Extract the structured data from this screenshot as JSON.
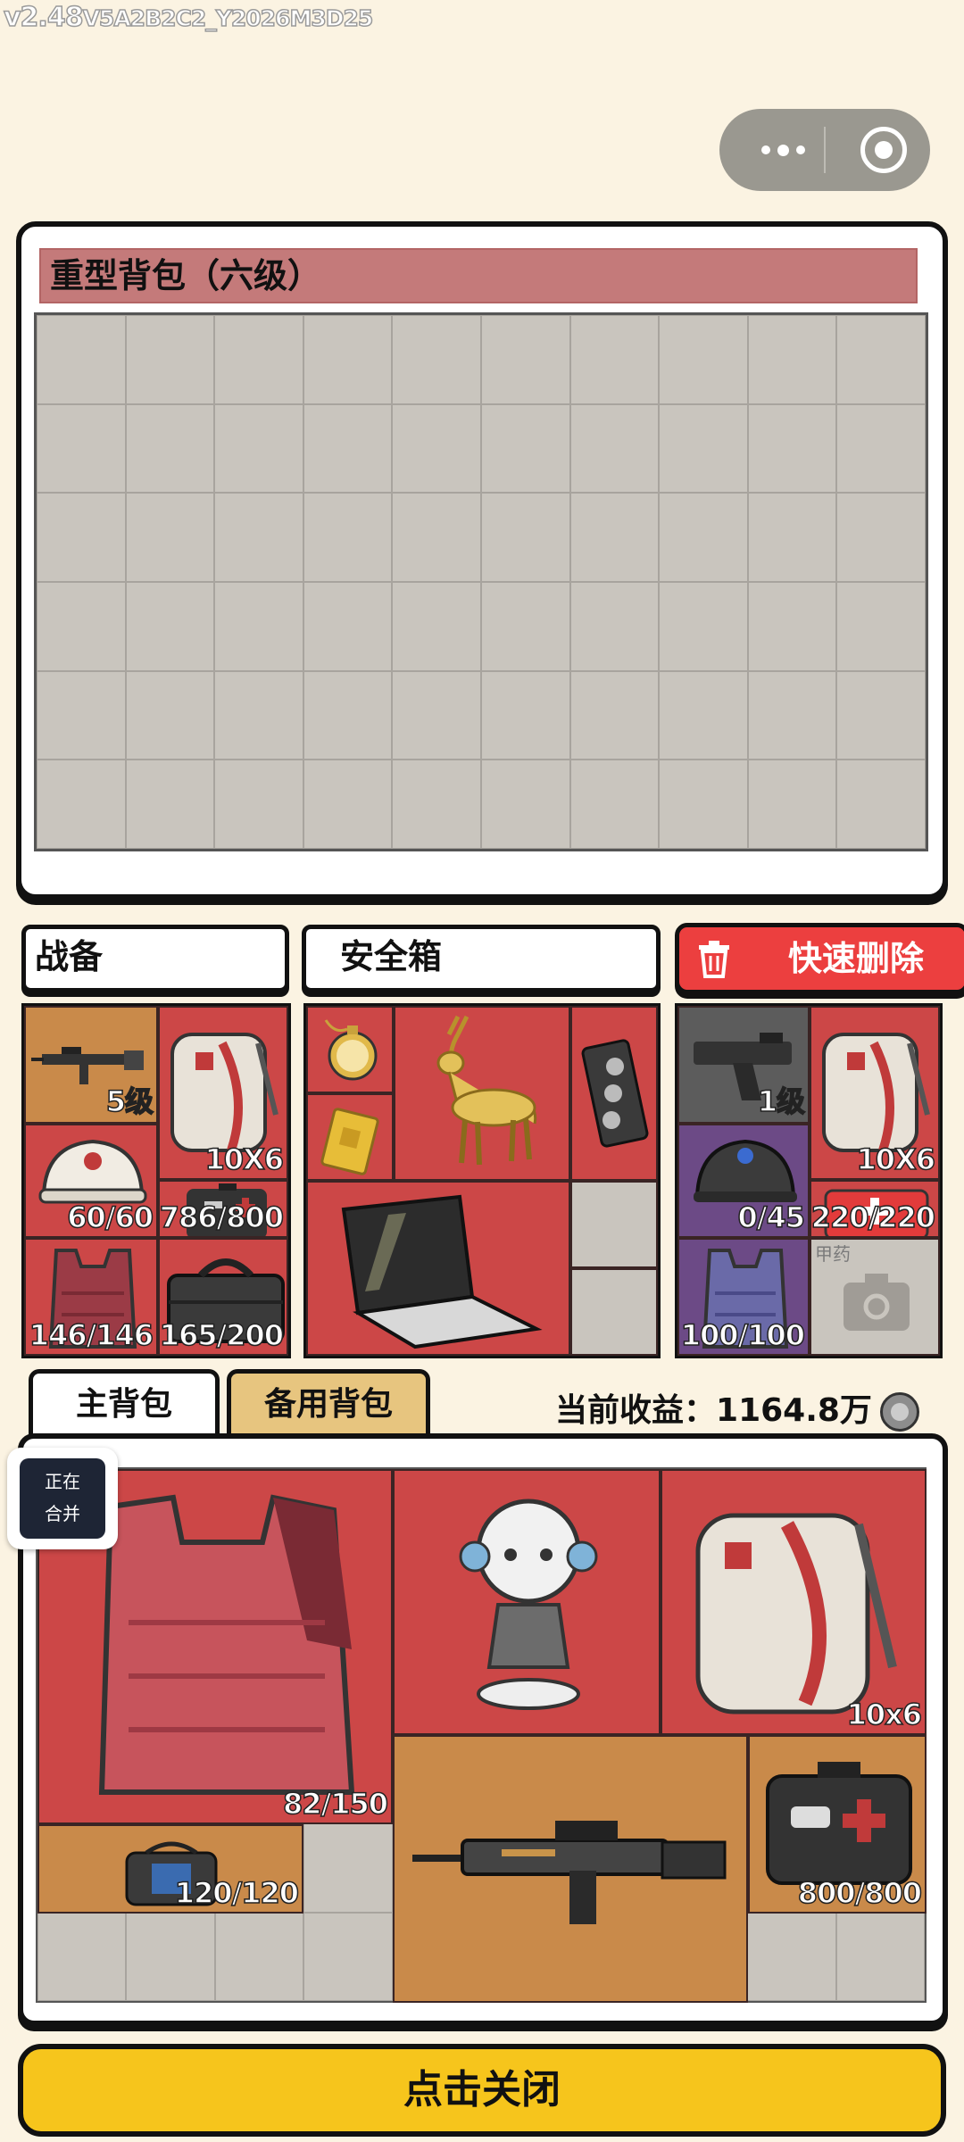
{
  "version": {
    "main": "v2.48",
    "build": "V5A2B2C2_Y2026M3D25"
  },
  "heavy_backpack": {
    "title": "重型背包（六级）"
  },
  "equipment": {
    "title": "战备",
    "slots": [
      {
        "item": "rifle",
        "value": "5级"
      },
      {
        "item": "backpack",
        "value": "10X6"
      },
      {
        "item": "helmet",
        "value": "60/60"
      },
      {
        "item": "medkit",
        "value": "786/800"
      },
      {
        "item": "armor-vest",
        "value": "146/146"
      },
      {
        "item": "tool-bag",
        "value": "165/200"
      }
    ]
  },
  "safe_box": {
    "title": "安全箱",
    "items": [
      "pocket-watch",
      "gold-deer",
      "graphics-card",
      "gold-bar",
      "laptop"
    ]
  },
  "quick_delete": {
    "label": "快速删除"
  },
  "opponent_equipment": {
    "slots": [
      {
        "item": "pistol",
        "value": "1级"
      },
      {
        "item": "backpack",
        "value": "10X6"
      },
      {
        "item": "helmet",
        "value": "0/45"
      },
      {
        "item": "medkit",
        "value": "220/220"
      },
      {
        "item": "armor-vest",
        "value": "100/100"
      },
      {
        "item": "empty-medicine",
        "value": "甲药"
      }
    ]
  },
  "tabs": {
    "main": "主背包",
    "spare": "备用背包"
  },
  "earnings": {
    "label": "当前收益：",
    "value": "1164.8万"
  },
  "merge_badge": {
    "line1": "正在",
    "line2": "合并"
  },
  "main_backpack": {
    "items": [
      {
        "item": "armor-vest",
        "value": "82/150"
      },
      {
        "item": "robot",
        "value": ""
      },
      {
        "item": "backpack",
        "value": "10x6"
      },
      {
        "item": "bag",
        "value": "120/120"
      },
      {
        "item": "rifle",
        "value": ""
      },
      {
        "item": "medkit",
        "value": "800/800"
      }
    ]
  },
  "close_button": {
    "label": "点击关闭"
  }
}
